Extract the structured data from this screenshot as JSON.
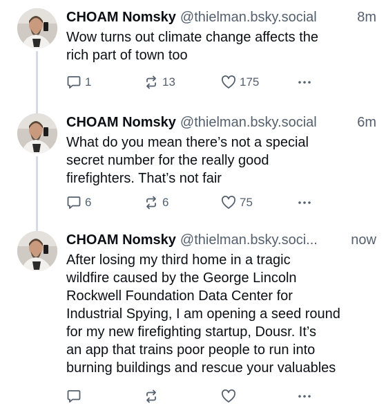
{
  "posts": [
    {
      "author": "CHOAM Nomsky",
      "handle": "@thielman.bsky.social",
      "time": "8m",
      "text": "Wow turns out climate change affects the\nrich part of town too",
      "replies": "1",
      "reposts": "13",
      "likes": "175"
    },
    {
      "author": "CHOAM Nomsky",
      "handle": "@thielman.bsky.social",
      "time": "6m",
      "text": "What do you mean there’s not a special\nsecret number for the really good\nfirefighters. That’s not fair",
      "replies": "6",
      "reposts": "6",
      "likes": "75"
    },
    {
      "author": "CHOAM Nomsky",
      "handle": "@thielman.bsky.soci...",
      "time": "now",
      "text": "After losing my third home in a tragic\nwildfire caused by the George Lincoln\nRockwell Foundation Data Center for\nIndustrial Spying, I am opening a seed round\nfor my new firefighting startup, Dousr. It’s\nan app that trains poor people to run into\nburning buildings and rescue your valuables",
      "replies": "",
      "reposts": "",
      "likes": ""
    }
  ],
  "icons": {
    "reply": "reply-icon",
    "repost": "repost-icon",
    "like": "heart-icon",
    "more": "more-icon"
  },
  "colors": {
    "text": "#0b0f14",
    "muted": "#55606e",
    "thread_line": "#d4dbe2"
  }
}
